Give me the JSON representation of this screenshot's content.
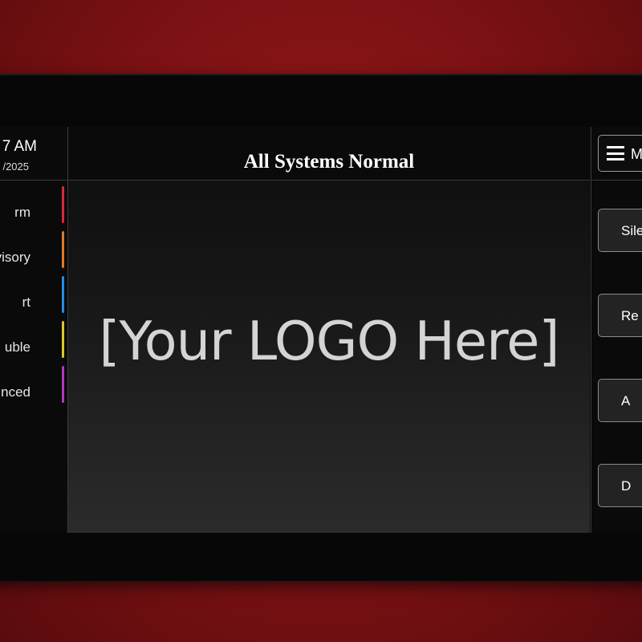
{
  "clock": {
    "time": "7 AM",
    "date": "/2025"
  },
  "status_items": [
    {
      "label": "rm",
      "color": "#d42a3a"
    },
    {
      "label": "pervisory",
      "color": "#e07a2a"
    },
    {
      "label": "rt",
      "color": "#2a8ae0"
    },
    {
      "label": "uble",
      "color": "#e0c42a"
    },
    {
      "label": "nced",
      "color": "#b03ab8"
    }
  ],
  "header": {
    "title": "All Systems Normal"
  },
  "logo": {
    "text": "[Your LOGO Here]"
  },
  "menu": {
    "label": "M",
    "icon": "hamburger-icon"
  },
  "actions": [
    {
      "label": "Sile"
    },
    {
      "label": "Re"
    },
    {
      "label": "A"
    },
    {
      "label": "D"
    }
  ]
}
